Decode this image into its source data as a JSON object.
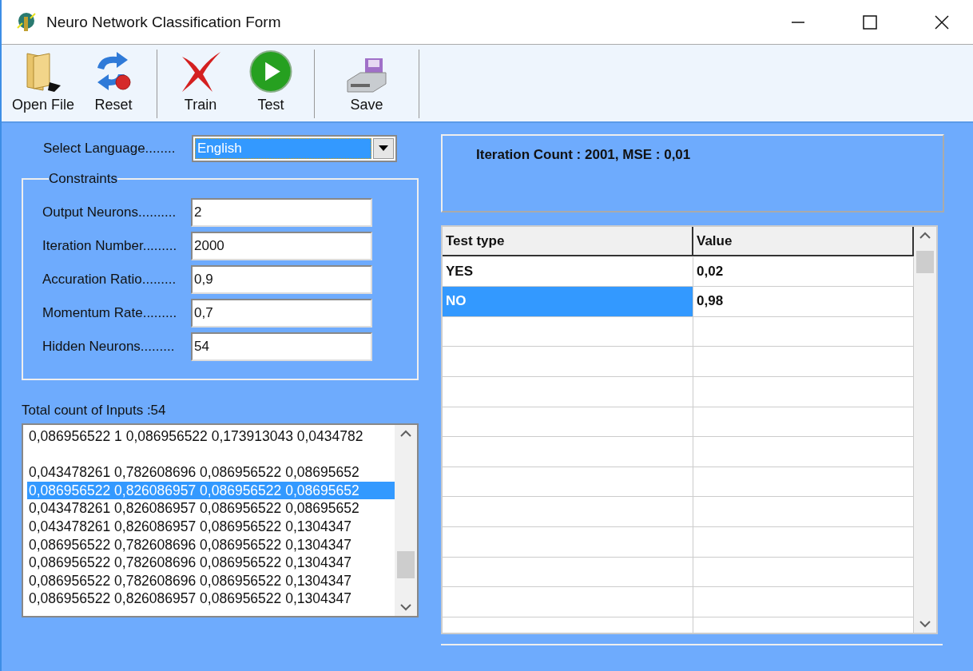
{
  "window": {
    "title": "Neuro Network Classification Form"
  },
  "toolbar": [
    {
      "kind": "open",
      "label": "Open File"
    },
    {
      "kind": "reset",
      "label": "Reset"
    },
    {
      "kind": "separator"
    },
    {
      "kind": "train",
      "label": "Train"
    },
    {
      "kind": "test",
      "label": "Test"
    },
    {
      "kind": "separator"
    },
    {
      "kind": "save",
      "label": "Save"
    },
    {
      "kind": "separator"
    }
  ],
  "language": {
    "label": "Select Language........",
    "value": "English"
  },
  "constraints": {
    "title": "Constraints",
    "fields": [
      {
        "label": "Output Neurons..........",
        "value": "2"
      },
      {
        "label": "Iteration Number.........",
        "value": "2000"
      },
      {
        "label": "Accuration Ratio.........",
        "value": "0,9"
      },
      {
        "label": "Momentum Rate.........",
        "value": "0,7"
      },
      {
        "label": "Hidden Neurons.........",
        "value": "54"
      }
    ]
  },
  "inputs": {
    "label": "Total count of Inputs :54",
    "lines": [
      {
        "kind": "text",
        "text": "0,086956522 1 0,086956522 0,173913043 0,0434782",
        "selected": false
      },
      {
        "kind": "blank"
      },
      {
        "kind": "text",
        "text": "0,043478261 0,782608696 0,086956522 0,08695652",
        "selected": false
      },
      {
        "kind": "text",
        "text": "0,086956522 0,826086957 0,086956522 0,08695652",
        "selected": true
      },
      {
        "kind": "text",
        "text": "0,043478261 0,826086957 0,086956522 0,08695652",
        "selected": false
      },
      {
        "kind": "text",
        "text": "0,043478261 0,826086957 0,086956522 0,1304347",
        "selected": false
      },
      {
        "kind": "text",
        "text": "0,086956522 0,782608696 0,086956522 0,1304347",
        "selected": false
      },
      {
        "kind": "text",
        "text": "0,086956522 0,782608696 0,086956522 0,1304347",
        "selected": false
      },
      {
        "kind": "text",
        "text": "0,086956522 0,782608696 0,086956522 0,1304347",
        "selected": false
      },
      {
        "kind": "text",
        "text": "0,086956522 0,826086957 0,086956522 0,1304347",
        "selected": false
      }
    ]
  },
  "status": {
    "text": "Iteration Count : 2001, MSE : 0,01"
  },
  "table": {
    "columns": [
      "Test type",
      "Value"
    ],
    "rows": [
      {
        "test_type": "YES",
        "value": "0,02",
        "selected": false
      },
      {
        "test_type": "NO",
        "value": "0,98",
        "selected": true
      }
    ]
  }
}
